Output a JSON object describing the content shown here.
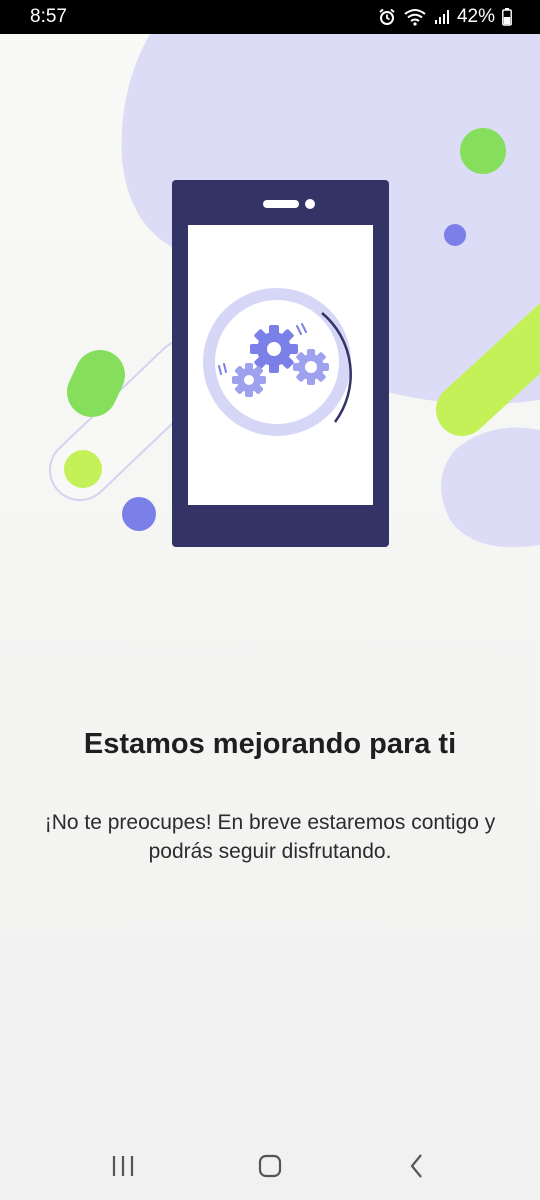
{
  "status_bar": {
    "time": "8:57",
    "battery_percent": "42%",
    "icons": [
      "alarm-icon",
      "wifi-icon",
      "signal-icon",
      "battery-icon"
    ]
  },
  "maintenance": {
    "title": "Estamos mejorando para ti",
    "message": "¡No te preocupes! En breve estaremos contigo y podrás seguir disfrutando."
  },
  "navigation": {
    "buttons": [
      "recent-apps-icon",
      "home-icon",
      "back-icon"
    ]
  },
  "colors": {
    "phone": "#333366",
    "blob": "#dcdcf7",
    "gear": "#7b7fe8",
    "green": "#86df5c",
    "lime": "#c4f158"
  }
}
